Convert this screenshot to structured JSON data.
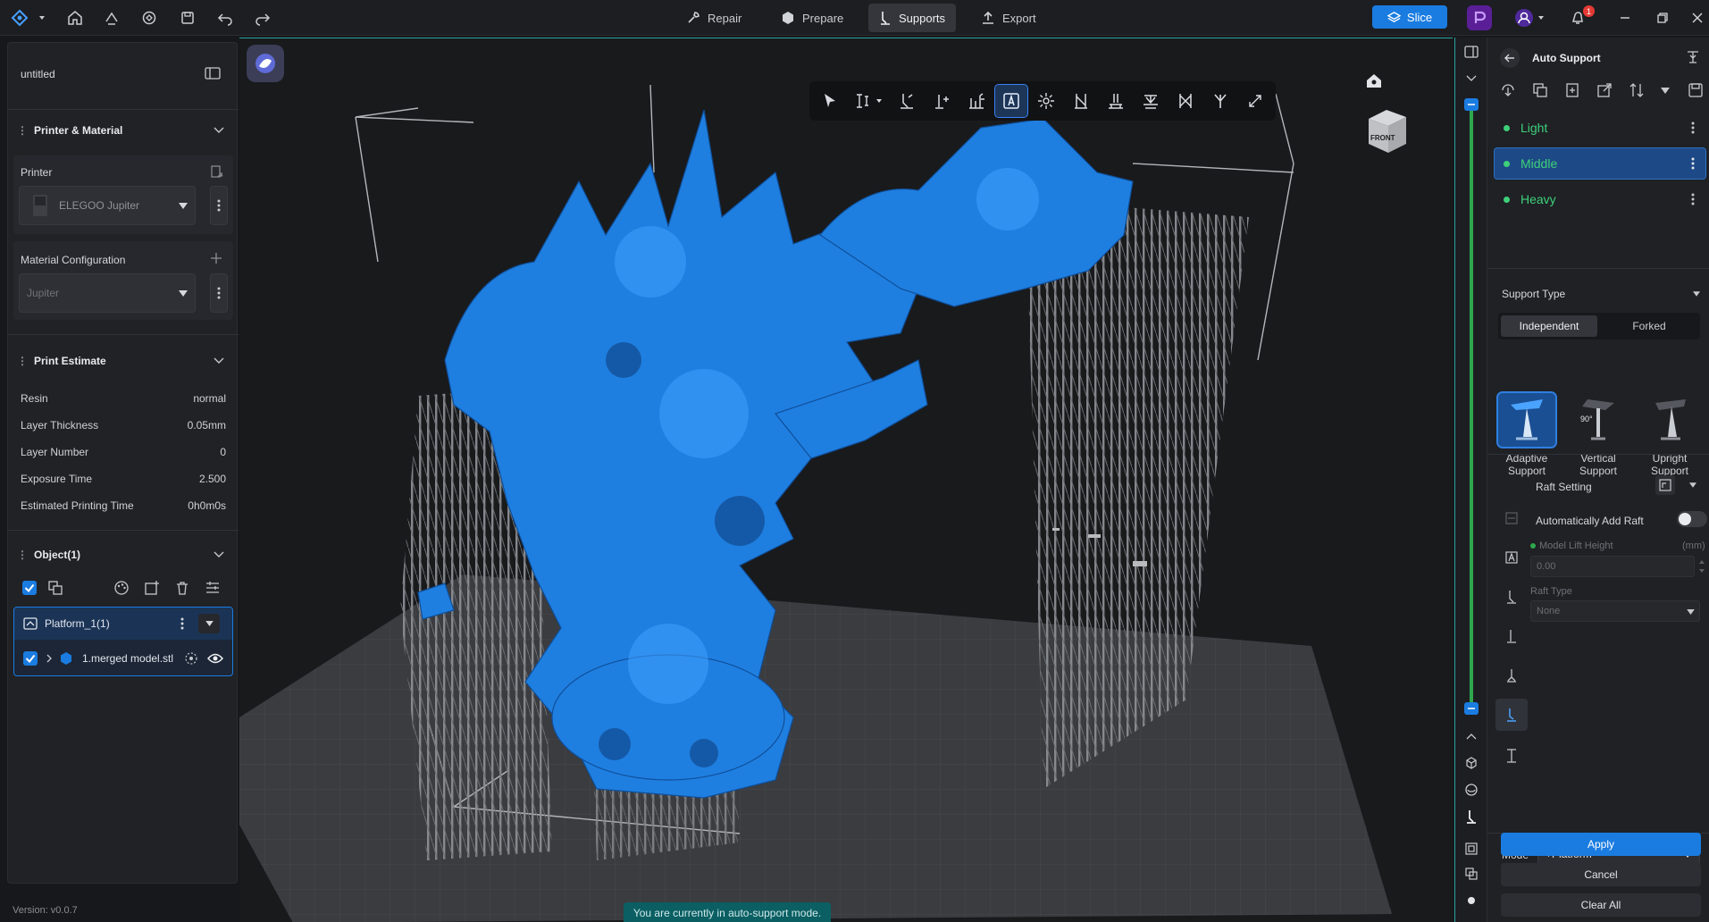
{
  "topbar": {
    "tabs": [
      {
        "label": "Repair"
      },
      {
        "label": "Prepare"
      },
      {
        "label": "Supports"
      },
      {
        "label": "Export"
      }
    ],
    "slice_label": "Slice",
    "notification_count": "1",
    "accent": "#1a7ce0"
  },
  "left": {
    "project_name": "untitled",
    "printer_section": {
      "title": "Printer & Material",
      "printer_label": "Printer",
      "printer_value": "ELEGOO Jupiter",
      "material_label": "Material Configuration",
      "material_value": "Jupiter"
    },
    "estimate": {
      "title": "Print Estimate",
      "rows": [
        {
          "label": "Resin",
          "value": "normal"
        },
        {
          "label": "Layer Thickness",
          "value": "0.05mm"
        },
        {
          "label": "Layer Number",
          "value": "0"
        },
        {
          "label": "Exposure Time",
          "value": "2.500"
        },
        {
          "label": "Estimated Printing Time",
          "value": "0h0m0s"
        }
      ]
    },
    "objects": {
      "title": "Object(1)",
      "platform": "Platform_1(1)",
      "model": "1.merged model.stl"
    },
    "version": "Version: v0.0.7"
  },
  "viewport": {
    "status": "You are currently in auto-support mode.",
    "cube_label": "FRONT",
    "model_color": "#1f7fe0",
    "support_color": "#8a8d92"
  },
  "right": {
    "title": "Auto Support",
    "presets": [
      {
        "label": "Light"
      },
      {
        "label": "Middle"
      },
      {
        "label": "Heavy"
      }
    ],
    "support_type_title": "Support Type",
    "type_tabs": [
      "Independent",
      "Forked"
    ],
    "type_cards": [
      {
        "label": "Adaptive Support"
      },
      {
        "label": "Vertical Support",
        "badge": "90°"
      },
      {
        "label": "Upright Support"
      }
    ],
    "raft": {
      "title": "Raft Setting",
      "auto_add": "Automatically Add Raft",
      "lift_label": "Model Lift Height",
      "lift_unit": "(mm)",
      "lift_value": "0.00",
      "raft_type_label": "Raft Type",
      "raft_type_value": "None"
    },
    "mode_label": "Mode",
    "mode_value": "+Platform",
    "apply": "Apply",
    "cancel": "Cancel",
    "clear_all": "Clear All"
  }
}
